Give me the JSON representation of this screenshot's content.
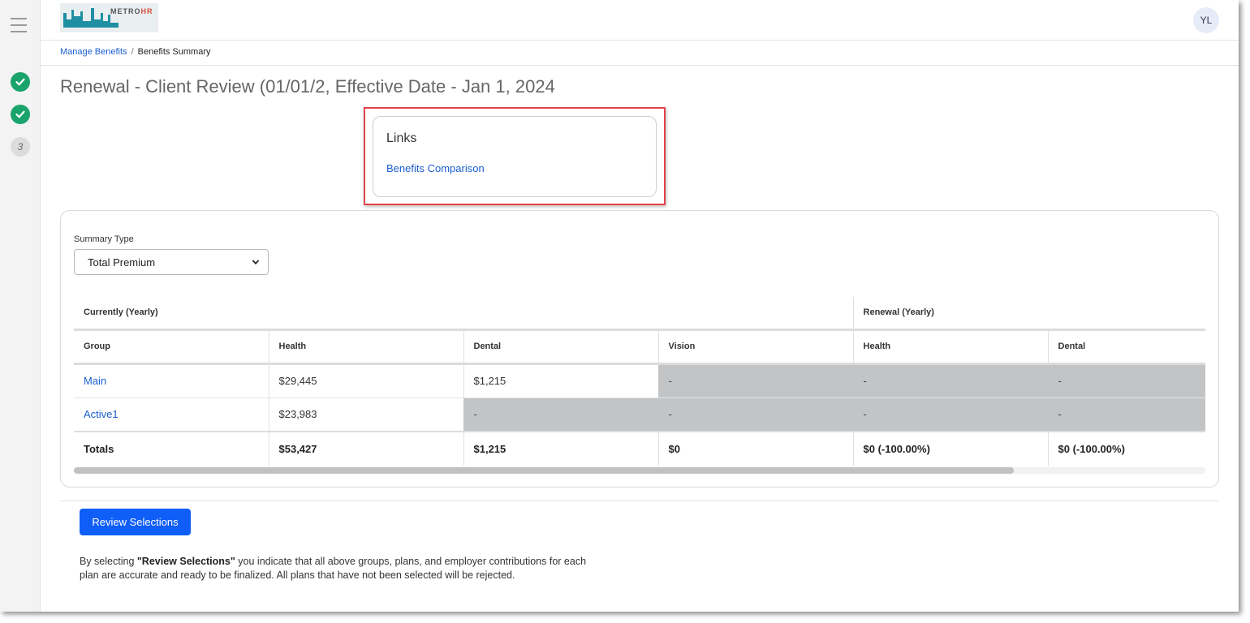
{
  "header": {
    "logo_text_prefix": "METRO",
    "logo_text_suffix": "HR",
    "avatar_initials": "YL"
  },
  "sidebar": {
    "steps": [
      {
        "state": "done",
        "icon": "check-icon"
      },
      {
        "state": "done",
        "icon": "check-icon"
      },
      {
        "state": "current",
        "label": "3"
      }
    ]
  },
  "breadcrumb": {
    "parent": "Manage Benefits",
    "separator": "/",
    "current": "Benefits Summary"
  },
  "page": {
    "title": "Renewal - Client Review (01/01/2, Effective Date - Jan 1, 2024"
  },
  "links_card": {
    "title": "Links",
    "items": [
      "Benefits Comparison"
    ]
  },
  "summary": {
    "type_label": "Summary Type",
    "type_value": "Total Premium",
    "group_headers": {
      "current": "Currently (Yearly)",
      "renewal": "Renewal (Yearly)"
    },
    "columns": [
      "Group",
      "Health",
      "Dental",
      "Vision",
      "Health",
      "Dental"
    ],
    "rows": [
      {
        "group": "Main",
        "cells": [
          "$29,445",
          "$1,215",
          "-",
          "-",
          "-"
        ]
      },
      {
        "group": "Active1",
        "cells": [
          "$23,983",
          "-",
          "-",
          "-",
          "-"
        ]
      }
    ],
    "totals": {
      "label": "Totals",
      "cells": [
        "$53,427",
        "$1,215",
        "$0",
        "$0 (-100.00%)",
        "$0 (-100.00%)"
      ]
    }
  },
  "actions": {
    "review_button": "Review Selections"
  },
  "disclaimer": {
    "prefix": "By selecting ",
    "emphasis": "\"Review Selections\"",
    "suffix": " you indicate that all above groups, plans, and employer contributions for each plan are accurate and ready to be finalized. All plans that have not been selected will be rejected."
  },
  "colors": {
    "accent": "#0f5ef7",
    "link": "#1a5fcf",
    "step_done": "#1aa36b",
    "highlight": "#e2434b",
    "na_cell": "#c2c4c6"
  }
}
